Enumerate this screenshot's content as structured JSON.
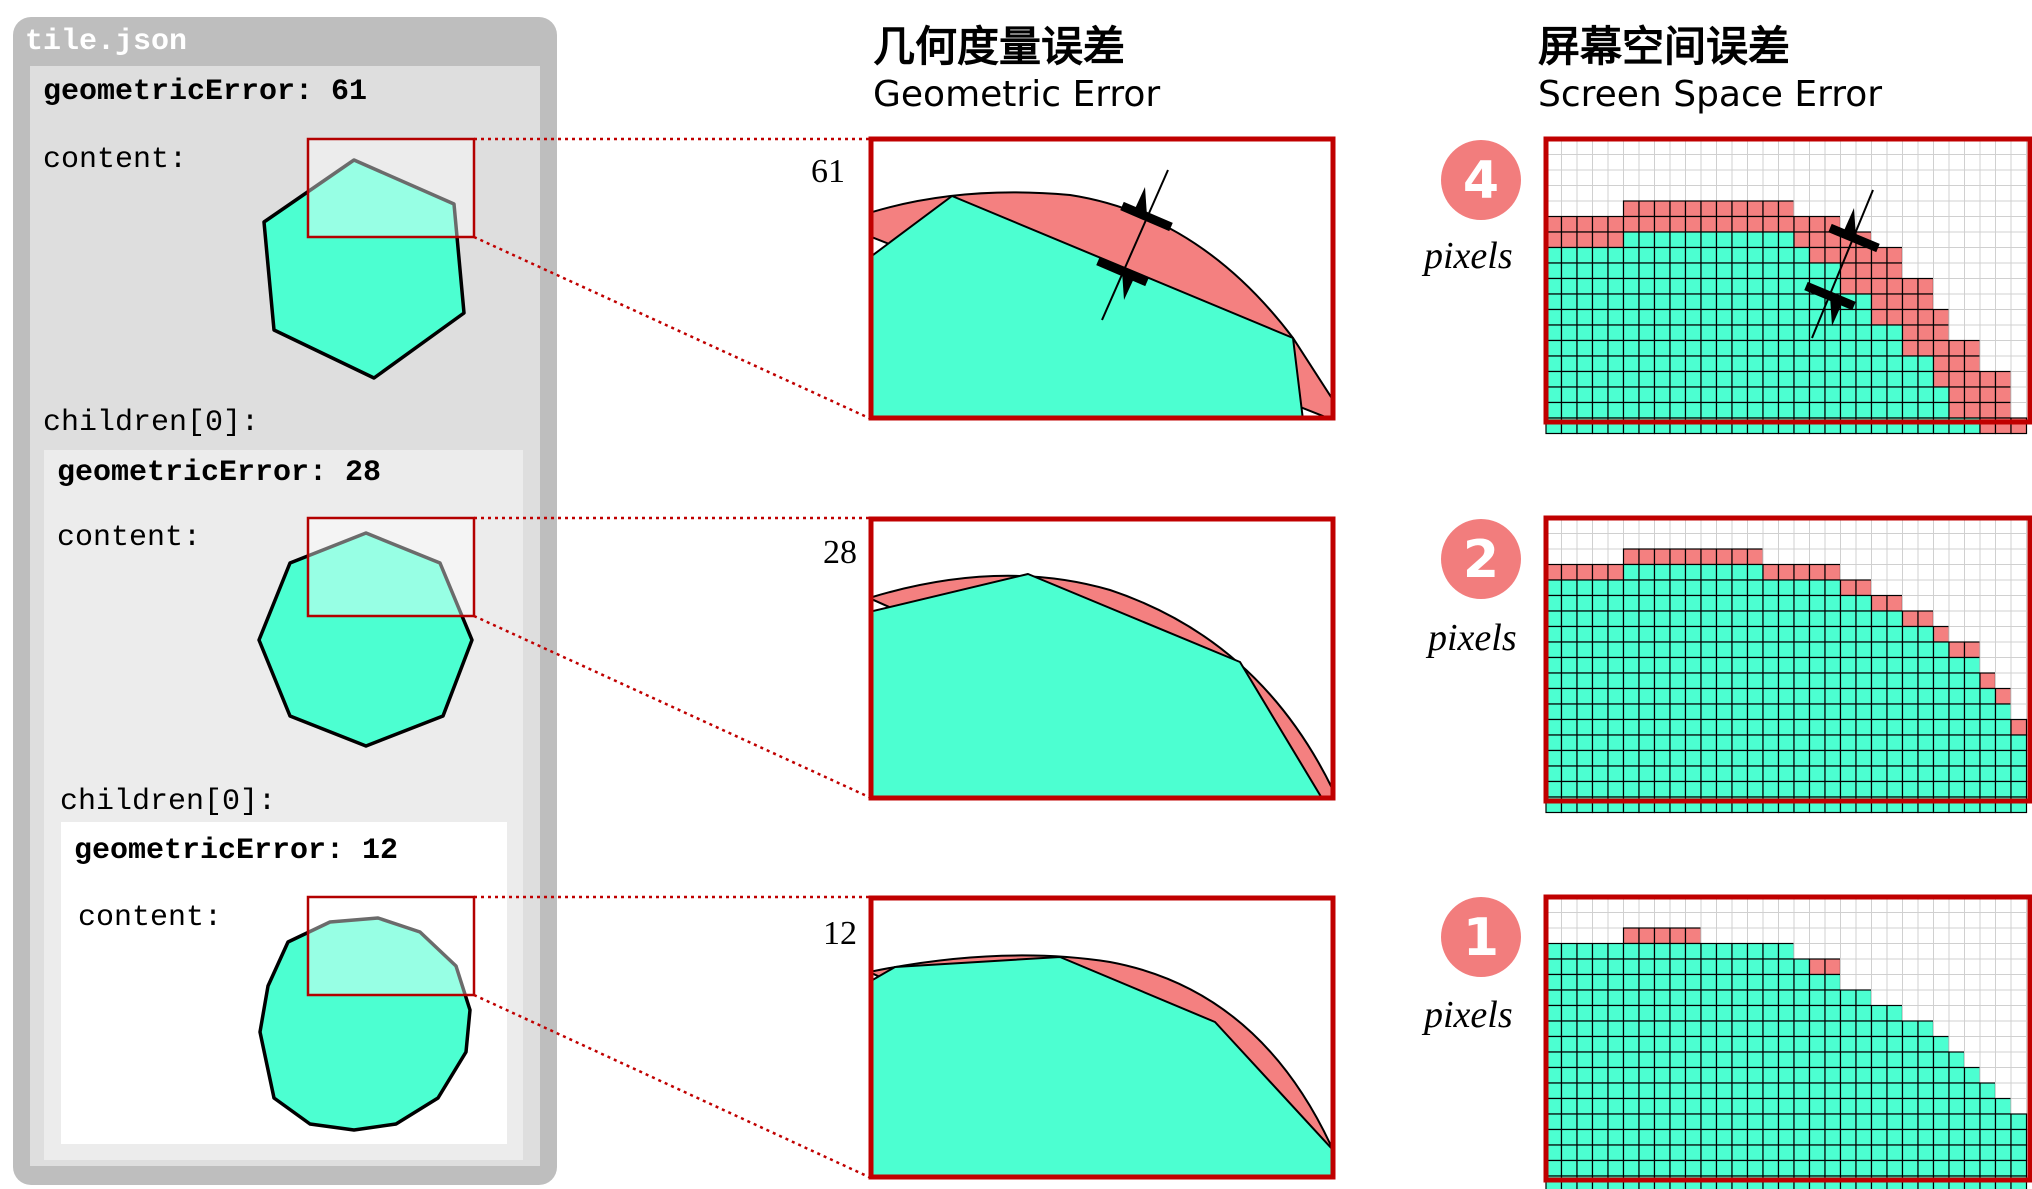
{
  "tile_json": {
    "title": "tile.json",
    "levels": [
      {
        "geometric_error_label": "geometricError: 61",
        "content_label": "content:"
      },
      {
        "children_label": "children[0]:",
        "geometric_error_label": "geometricError:  28",
        "content_label": "content:"
      },
      {
        "children_label": "children[0]:",
        "geometric_error_label": "geometricError:  12",
        "content_label": "content:"
      }
    ]
  },
  "geometric_error": {
    "title_cn": "几何度量误差",
    "title_en": "Geometric Error",
    "values": [
      "61",
      "28",
      "12"
    ]
  },
  "screen_space_error": {
    "title_cn": "屏幕空间误差",
    "title_en": "Screen Space Error",
    "values": [
      "4",
      "2",
      "1"
    ],
    "unit": "pixels"
  },
  "colors": {
    "fill": "#4cffd1",
    "error": "#f48080",
    "frame": "#c00000",
    "badge": "#f27d7d",
    "panel_outer": "#bebebe",
    "panel_mid": "#dedede",
    "panel_inner": "#ececec",
    "panel_innermost": "#ffffff"
  },
  "icons": [
    "dimension-arrow-icon"
  ]
}
